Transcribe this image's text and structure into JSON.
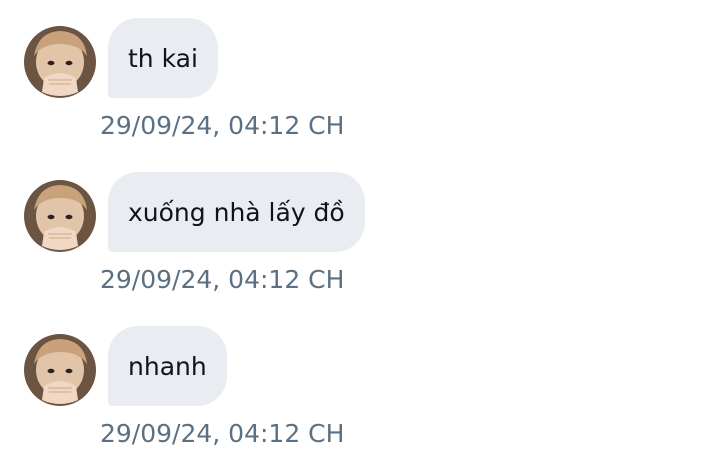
{
  "messages": [
    {
      "text": "th kai",
      "time": "29/09/24, 04:12 CH"
    },
    {
      "text": "xuống nhà lấy đồ",
      "time": "29/09/24, 04:12 CH"
    },
    {
      "text": "nhanh",
      "time": "29/09/24, 04:12 CH"
    }
  ],
  "avatar_icon": "user-photo-avatar",
  "colors": {
    "bubble_bg": "#e9edf1",
    "message_text": "#0f1419",
    "timestamp_text": "#5b7083",
    "background": "#ffffff"
  }
}
